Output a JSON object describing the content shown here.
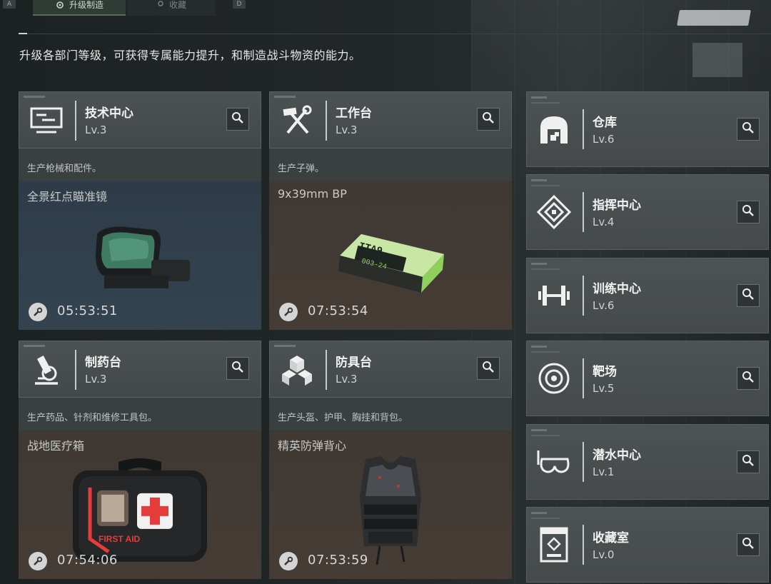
{
  "tabs": [
    {
      "key": "A",
      "label": "升级制造"
    },
    {
      "label": "收藏"
    },
    {
      "key": "D"
    }
  ],
  "intro": "升级各部门等级，可获得专属能力提升，和制造战斗物资的能力。",
  "stations": [
    {
      "name": "技术中心",
      "level": "Lv.3",
      "desc": "生产枪械和配件。",
      "craft_item": "全景红点瞄准镜",
      "craft_time": "05:53:51",
      "icon": "monitor-icon",
      "bg": "blue"
    },
    {
      "name": "工作台",
      "level": "Lv.3",
      "desc": "生产子弹。",
      "craft_item": "9x39mm BP",
      "craft_time": "07:53:54",
      "icon": "hammer-wrench-icon",
      "bg": "brown"
    },
    {
      "name": "制药台",
      "level": "Lv.3",
      "desc": "生产药品、针剂和维修工具包。",
      "craft_item": "战地医疗箱",
      "craft_time": "07:54:06",
      "icon": "microscope-icon",
      "bg": "brown"
    },
    {
      "name": "防具台",
      "level": "Lv.3",
      "desc": "生产头盔、护甲、胸挂和背包。",
      "craft_item": "精英防弹背心",
      "craft_time": "07:53:59",
      "icon": "cubes-icon",
      "bg": "brown"
    }
  ],
  "side_stations": [
    {
      "name": "仓库",
      "level": "Lv.6",
      "icon": "warehouse-icon"
    },
    {
      "name": "指挥中心",
      "level": "Lv.4",
      "icon": "command-icon"
    },
    {
      "name": "训练中心",
      "level": "Lv.6",
      "icon": "dumbbell-icon"
    },
    {
      "name": "靶场",
      "level": "Lv.5",
      "icon": "target-icon"
    },
    {
      "name": "潜水中心",
      "level": "Lv.1",
      "icon": "diving-mask-icon"
    },
    {
      "name": "收藏室",
      "level": "Lv.0",
      "icon": "display-case-icon"
    }
  ],
  "item_labels": {
    "ammo_box_label": "ITA9",
    "ammo_box_code": "003-24",
    "medkit_label": "FIRST AID"
  },
  "colors": {
    "accent_red": "#e63b3b",
    "ammo_green": "#9bd36a"
  }
}
